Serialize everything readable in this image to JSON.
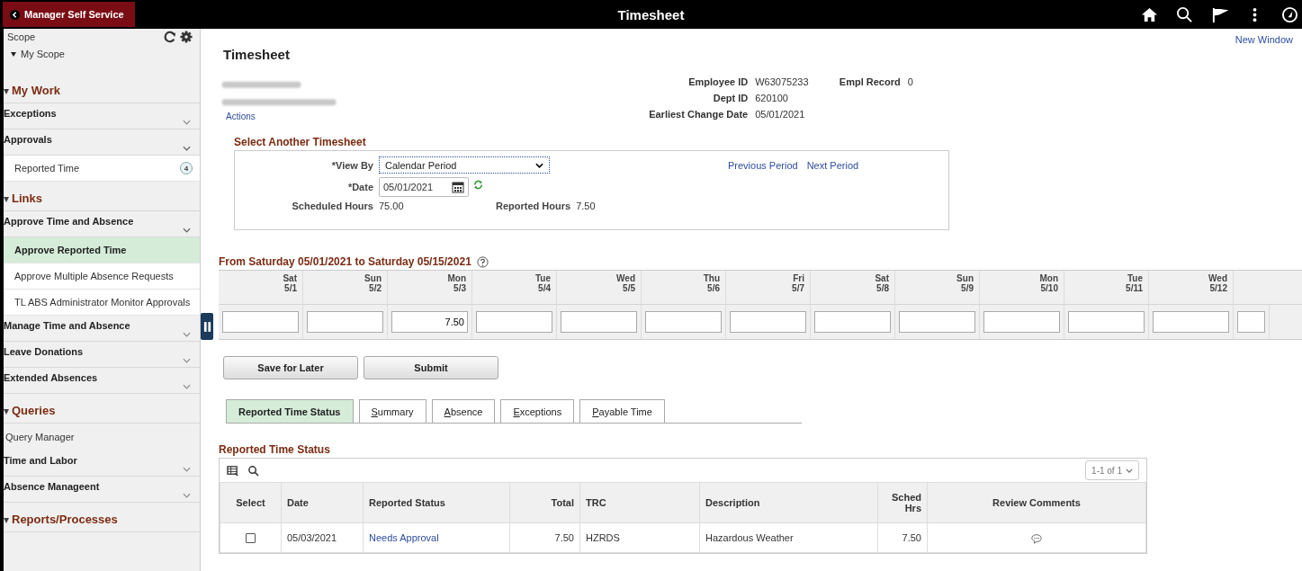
{
  "topbar": {
    "back_label": "Manager Self Service",
    "title": "Timesheet"
  },
  "sidebar": {
    "scope_label": "Scope",
    "scope_value": "My Scope",
    "expanded": true,
    "items": [
      {
        "kind": "section",
        "label": "My Work",
        "expanded": true
      },
      {
        "kind": "group",
        "label": "Exceptions",
        "expanded": false
      },
      {
        "kind": "group",
        "label": "Approvals",
        "expanded": true
      },
      {
        "kind": "link",
        "label": "Reported Time",
        "badge": "4",
        "selected": false
      },
      {
        "kind": "section",
        "label": "Links",
        "expanded": true
      },
      {
        "kind": "group",
        "label": "Approve Time and Absence",
        "expanded": true
      },
      {
        "kind": "link",
        "label": "Approve Reported Time",
        "selected": true
      },
      {
        "kind": "link",
        "label": "Approve Multiple Absence Requests",
        "selected": false
      },
      {
        "kind": "link",
        "label": "TL ABS Administrator Monitor Approvals",
        "selected": false
      },
      {
        "kind": "group",
        "label": "Manage Time and Absence",
        "expanded": false
      },
      {
        "kind": "group",
        "label": "Leave Donations",
        "expanded": false
      },
      {
        "kind": "group",
        "label": "Extended Absences",
        "expanded": false
      },
      {
        "kind": "section",
        "label": "Queries",
        "expanded": true
      },
      {
        "kind": "plain",
        "label": "Query Manager"
      },
      {
        "kind": "group",
        "label": "Time and Labor",
        "expanded": false
      },
      {
        "kind": "group",
        "label": "Absence Manageent",
        "expanded": false
      },
      {
        "kind": "section",
        "label": "Reports/Processes",
        "expanded": true
      }
    ]
  },
  "new_window": "New Window",
  "page_title": "Timesheet",
  "actions": "Actions",
  "employee": [
    {
      "label": "Employee ID",
      "value": "W63075233"
    },
    {
      "label": "Empl Record",
      "value": "0"
    },
    {
      "label": "Dept ID",
      "value": "620100"
    },
    {
      "label": "Earliest Change Date",
      "value": "05/01/2021"
    }
  ],
  "select_timesheet": {
    "title": "Select Another Timesheet",
    "view_by_label": "*View By",
    "view_by": "Calendar Period",
    "date_label": "*Date",
    "date": "05/01/2021",
    "previous": "Previous Period",
    "next": "Next Period",
    "scheduled_label": "Scheduled Hours",
    "scheduled": "75.00",
    "reported_label": "Reported Hours",
    "reported": "7.50"
  },
  "period_title": "From Saturday 05/01/2021 to Saturday 05/15/2021",
  "days": [
    {
      "day": "Sat",
      "date": "5/1"
    },
    {
      "day": "Sun",
      "date": "5/2"
    },
    {
      "day": "Mon",
      "date": "5/3",
      "value": "7.50"
    },
    {
      "day": "Tue",
      "date": "5/4"
    },
    {
      "day": "Wed",
      "date": "5/5"
    },
    {
      "day": "Thu",
      "date": "5/6"
    },
    {
      "day": "Fri",
      "date": "5/7"
    },
    {
      "day": "Sat",
      "date": "5/8"
    },
    {
      "day": "Sun",
      "date": "5/9"
    },
    {
      "day": "Mon",
      "date": "5/10"
    },
    {
      "day": "Tue",
      "date": "5/11"
    },
    {
      "day": "Wed",
      "date": "5/12"
    }
  ],
  "buttons": [
    "Save for Later",
    "Submit"
  ],
  "tabs": [
    {
      "label": "Reported Time Status",
      "selected": true,
      "underlined_key": false
    },
    {
      "label": "Summary",
      "selected": false,
      "underlined_key": true
    },
    {
      "label": "Absence",
      "selected": false,
      "underlined_key": true
    },
    {
      "label": "Exceptions",
      "selected": false,
      "underlined_key": true
    },
    {
      "label": "Payable Time",
      "selected": false,
      "underlined_key": true
    }
  ],
  "status_table": {
    "title": "Reported Time Status",
    "pager": "1-1 of 1",
    "columns": [
      "Select",
      "Date",
      "Reported Status",
      "Total",
      "TRC",
      "Description",
      "Sched Hrs",
      "Review Comments"
    ],
    "rows": [
      {
        "checked": false,
        "date": "05/03/2021",
        "status": "Needs Approval",
        "total": "7.50",
        "trc": "HZRDS",
        "description": "Hazardous Weather",
        "sched": "7.50"
      }
    ]
  }
}
